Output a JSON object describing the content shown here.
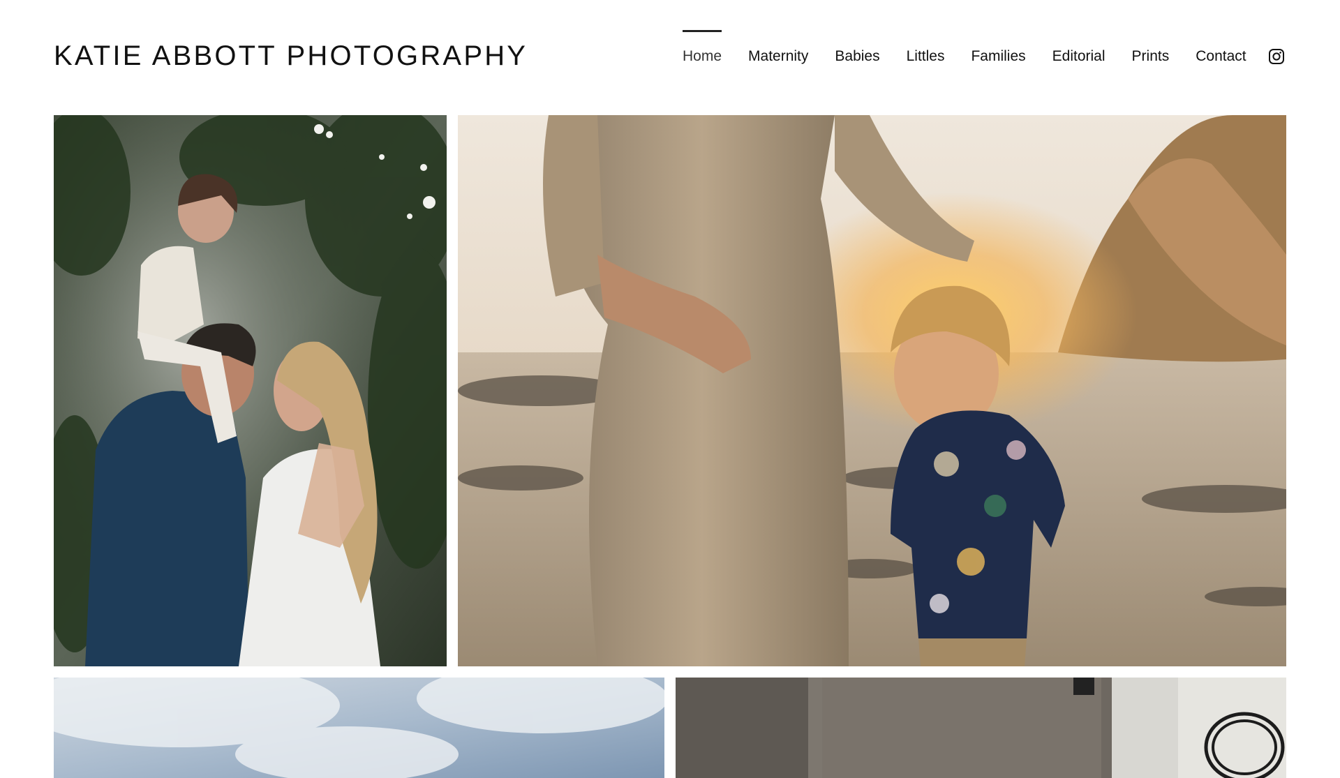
{
  "site": {
    "title": "KATIE ABBOTT PHOTOGRAPHY"
  },
  "nav": {
    "items": [
      {
        "label": "Home",
        "active": true
      },
      {
        "label": "Maternity",
        "active": false
      },
      {
        "label": "Babies",
        "active": false
      },
      {
        "label": "Littles",
        "active": false
      },
      {
        "label": "Families",
        "active": false
      },
      {
        "label": "Editorial",
        "active": false
      },
      {
        "label": "Prints",
        "active": false
      },
      {
        "label": "Contact",
        "active": false
      }
    ],
    "social_icon": "instagram-icon"
  },
  "gallery": {
    "photos": [
      {
        "subject": "family-portrait-photo"
      },
      {
        "subject": "maternity-beach-photo"
      },
      {
        "subject": "sky-photo"
      },
      {
        "subject": "interior-photo"
      }
    ]
  },
  "colors": {
    "text": "#111111",
    "background": "#ffffff",
    "active_indicator": "#222222"
  }
}
